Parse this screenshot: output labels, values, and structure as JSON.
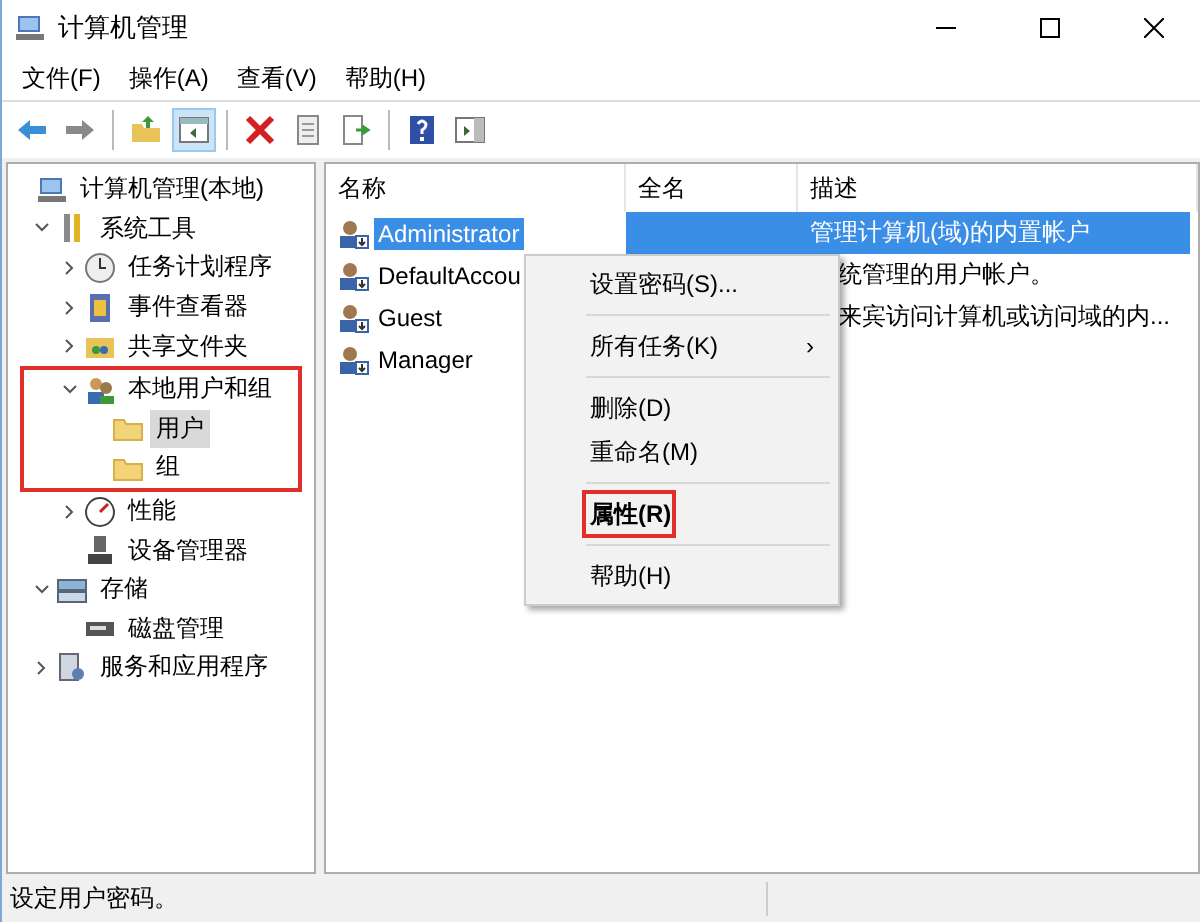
{
  "window": {
    "title": "计算机管理"
  },
  "menu": [
    "文件(F)",
    "操作(A)",
    "查看(V)",
    "帮助(H)"
  ],
  "toolbar": [
    {
      "kind": "back",
      "pressed": false
    },
    {
      "kind": "forward",
      "pressed": false
    },
    {
      "kind": "separator"
    },
    {
      "kind": "up",
      "pressed": false
    },
    {
      "kind": "tree",
      "pressed": true
    },
    {
      "kind": "separator"
    },
    {
      "kind": "delete",
      "pressed": false
    },
    {
      "kind": "properties",
      "pressed": false
    },
    {
      "kind": "export",
      "pressed": false
    },
    {
      "kind": "separator"
    },
    {
      "kind": "help",
      "pressed": false
    },
    {
      "kind": "pane",
      "pressed": false
    }
  ],
  "tree": [
    {
      "label": "计算机管理(本地)",
      "kind": "computer",
      "selected": false,
      "children": [
        {
          "label": "系统工具",
          "kind": "tools",
          "expanded": true,
          "selected": false,
          "children": [
            {
              "label": "任务计划程序",
              "kind": "clock",
              "expanded": false,
              "selected": false
            },
            {
              "label": "事件查看器",
              "kind": "log",
              "expanded": false,
              "selected": false
            },
            {
              "label": "共享文件夹",
              "kind": "share",
              "expanded": false,
              "selected": false
            },
            {
              "label": "本地用户和组",
              "kind": "users",
              "expanded": true,
              "selected": false,
              "highlight": true,
              "children": [
                {
                  "label": "用户",
                  "kind": "folder",
                  "selected": true
                },
                {
                  "label": "组",
                  "kind": "folder",
                  "selected": false
                }
              ]
            },
            {
              "label": "性能",
              "kind": "gauge",
              "expanded": false,
              "selected": false
            },
            {
              "label": "设备管理器",
              "kind": "device",
              "selected": false
            }
          ]
        },
        {
          "label": "存储",
          "kind": "storage",
          "expanded": true,
          "selected": false,
          "children": [
            {
              "label": "磁盘管理",
              "kind": "disk",
              "selected": false
            }
          ]
        },
        {
          "label": "服务和应用程序",
          "kind": "services",
          "expanded": false,
          "selected": false
        }
      ]
    }
  ],
  "list": {
    "columns": [
      "名称",
      "全名",
      "描述"
    ],
    "rows": [
      {
        "name": "Administrator",
        "description": "管理计算机(域)的内置帐户",
        "selected": true
      },
      {
        "name": "DefaultAccou",
        "description": "统管理的用户帐户。",
        "selected": false,
        "kind": "partial"
      },
      {
        "name": "Guest",
        "description": "来宾访问计算机或访问域的内...",
        "selected": false,
        "kind": "partial"
      },
      {
        "name": "Manager",
        "selected": false
      }
    ]
  },
  "context_menu": [
    {
      "label": "设置密码(S)...",
      "kind": "item"
    },
    {
      "kind": "separator"
    },
    {
      "label": "所有任务(K)",
      "kind": "submenu",
      "arrow": "›"
    },
    {
      "kind": "separator"
    },
    {
      "label": "删除(D)",
      "kind": "item"
    },
    {
      "label": "重命名(M)",
      "kind": "item"
    },
    {
      "kind": "separator"
    },
    {
      "label": "属性(R)",
      "kind": "item",
      "bold": true,
      "highlight": true
    },
    {
      "kind": "separator"
    },
    {
      "label": "帮助(H)",
      "kind": "item"
    }
  ],
  "status_bar": "设定用户密码。"
}
